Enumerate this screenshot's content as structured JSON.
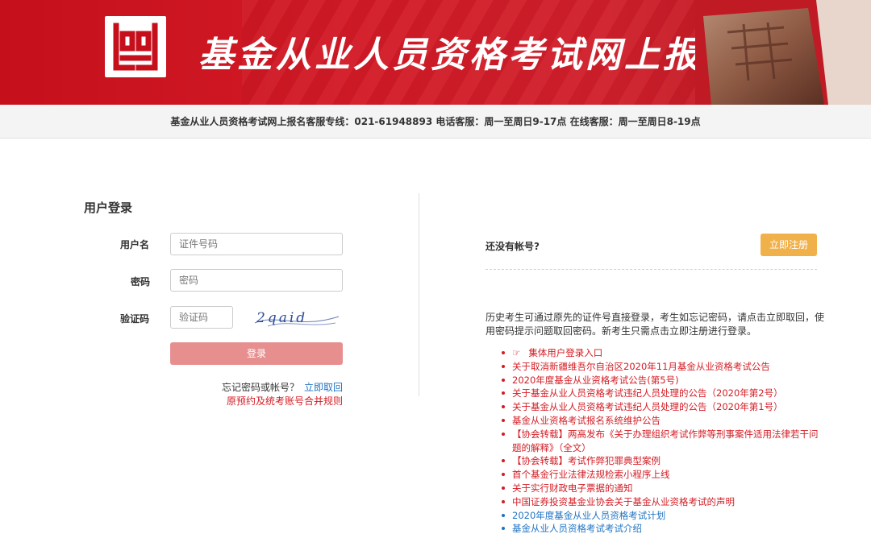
{
  "banner": {
    "title": "基金从业人员资格考试网上报名",
    "logo_icon": "amac-logo-icon",
    "colors": {
      "primary": "#c5101c",
      "accent": "#f0b04a",
      "link": "#1f73c3"
    }
  },
  "infobar": {
    "text": "基金从业人员资格考试网上报名客服专线：021-61948893 电话客服：周一至周日9-17点 在线客服：周一至周日8-19点"
  },
  "login": {
    "title": "用户登录",
    "username_label": "用户名",
    "username_placeholder": "证件号码",
    "password_label": "密码",
    "password_placeholder": "密码",
    "captcha_label": "验证码",
    "captcha_placeholder": "验证码",
    "captcha_text": "2qaid",
    "submit_label": "登录",
    "forgot_text": "忘记密码或帐号？",
    "retrieve_link": "立即取回",
    "merge_rule_link": "原预约及统考账号合并规则"
  },
  "register": {
    "no_account_text": "还没有帐号?",
    "register_button": "立即注册",
    "description": "历史考生可通过原先的证件号直接登录，考生如忘记密码，请点击立即取回，使用密码提示问题取回密码。新考生只需点击立即注册进行登录。"
  },
  "notices": [
    {
      "label": "集体用户登录入口",
      "icon": "☞",
      "color": "red"
    },
    {
      "label": "关于取消新疆维吾尔自治区2020年11月基金从业资格考试公告",
      "color": "red"
    },
    {
      "label": "2020年度基金从业资格考试公告(第5号)",
      "color": "red"
    },
    {
      "label": "关于基金从业人员资格考试违纪人员处理的公告（2020年第2号）",
      "color": "red"
    },
    {
      "label": "关于基金从业人员资格考试违纪人员处理的公告（2020年第1号）",
      "color": "red"
    },
    {
      "label": "基金从业资格考试报名系统维护公告",
      "color": "red"
    },
    {
      "label": "【协会转载】两高发布《关于办理组织考试作弊等刑事案件适用法律若干问题的解释》（全文）",
      "color": "red"
    },
    {
      "label": "【协会转载】考试作弊犯罪典型案例",
      "color": "red"
    },
    {
      "label": "首个基金行业法律法规检索小程序上线",
      "color": "red"
    },
    {
      "label": "关于实行财政电子票据的通知",
      "color": "red"
    },
    {
      "label": "中国证券投资基金业协会关于基金从业资格考试的声明",
      "color": "red"
    },
    {
      "label": "2020年度基金从业人员资格考试计划",
      "color": "blue"
    },
    {
      "label": "基金从业人员资格考试考试介绍",
      "color": "blue"
    }
  ]
}
